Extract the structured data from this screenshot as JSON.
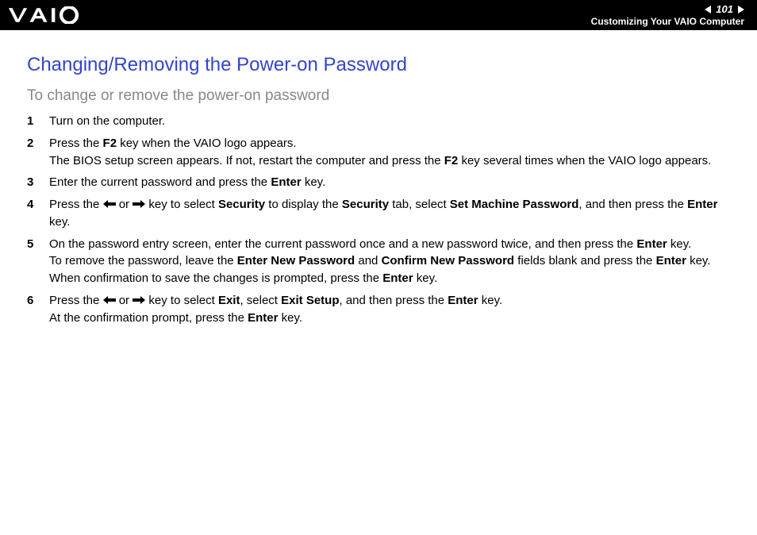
{
  "header": {
    "page_number": "101",
    "breadcrumb": "Customizing Your VAIO Computer"
  },
  "title": "Changing/Removing the Power-on Password",
  "subtitle": "To change or remove the power-on password",
  "steps": [
    {
      "num": "1",
      "html": "Turn on the computer."
    },
    {
      "num": "2",
      "html": "Press the <b>F2</b> key when the VAIO logo appears.<br>The BIOS setup screen appears. If not, restart the computer and press the <b>F2</b> key several times when the VAIO logo appears."
    },
    {
      "num": "3",
      "html": "Enter the current password and press the <b>Enter</b> key."
    },
    {
      "num": "4",
      "html": "Press the {ARROW_LEFT} or {ARROW_RIGHT} key to select <b>Security</b> to display the <b>Security</b> tab, select <b>Set Machine Password</b>, and then press the <b>Enter</b> key."
    },
    {
      "num": "5",
      "html": "On the password entry screen, enter the current password once and a new password twice, and then press the <b>Enter</b> key.<br>To remove the password, leave the <b>Enter New Password</b> and <b>Confirm New Password</b> fields blank and press the <b>Enter</b> key.<br>When confirmation to save the changes is prompted, press the <b>Enter</b> key."
    },
    {
      "num": "6",
      "html": "Press the {ARROW_LEFT} or {ARROW_RIGHT} key to select <b>Exit</b>, select <b>Exit Setup</b>, and then press the <b>Enter</b> key.<br>At the confirmation prompt, press the <b>Enter</b> key."
    }
  ]
}
